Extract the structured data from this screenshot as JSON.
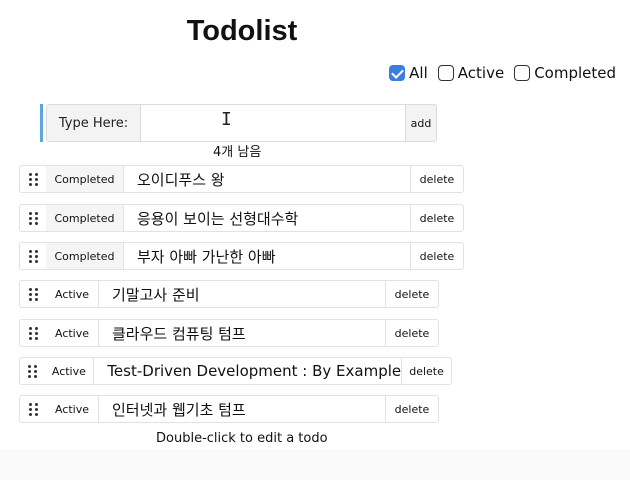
{
  "title": "Todolist",
  "filters": {
    "all": {
      "label": "All",
      "checked": true
    },
    "active": {
      "label": "Active",
      "checked": false
    },
    "completed": {
      "label": "Completed",
      "checked": false
    }
  },
  "input": {
    "prefix_label": "Type Here:",
    "value": "",
    "add_label": "add"
  },
  "remaining_text": "4개 남음",
  "todos": [
    {
      "status": "Completed",
      "text": "오이디푸스 왕",
      "delete_label": "delete"
    },
    {
      "status": "Completed",
      "text": "응용이 보이는 선형대수학",
      "delete_label": "delete"
    },
    {
      "status": "Completed",
      "text": "부자 아빠 가난한 아빠",
      "delete_label": "delete"
    },
    {
      "status": "Active",
      "text": "기말고사 준비",
      "delete_label": "delete"
    },
    {
      "status": "Active",
      "text": "클라우드 컴퓨팅 텀프",
      "delete_label": "delete"
    },
    {
      "status": "Active",
      "text": "Test-Driven Development : By Example",
      "delete_label": "delete"
    },
    {
      "status": "Active",
      "text": "인터넷과 웹기초 텀프",
      "delete_label": "delete"
    }
  ],
  "footer_hint": "Double-click to edit a todo",
  "colors": {
    "accent": "#3b7de0",
    "input_border_accent": "#5aa7df"
  },
  "icons": {
    "drag": "drag-handle-icon",
    "text_cursor": "text-cursor-icon"
  }
}
